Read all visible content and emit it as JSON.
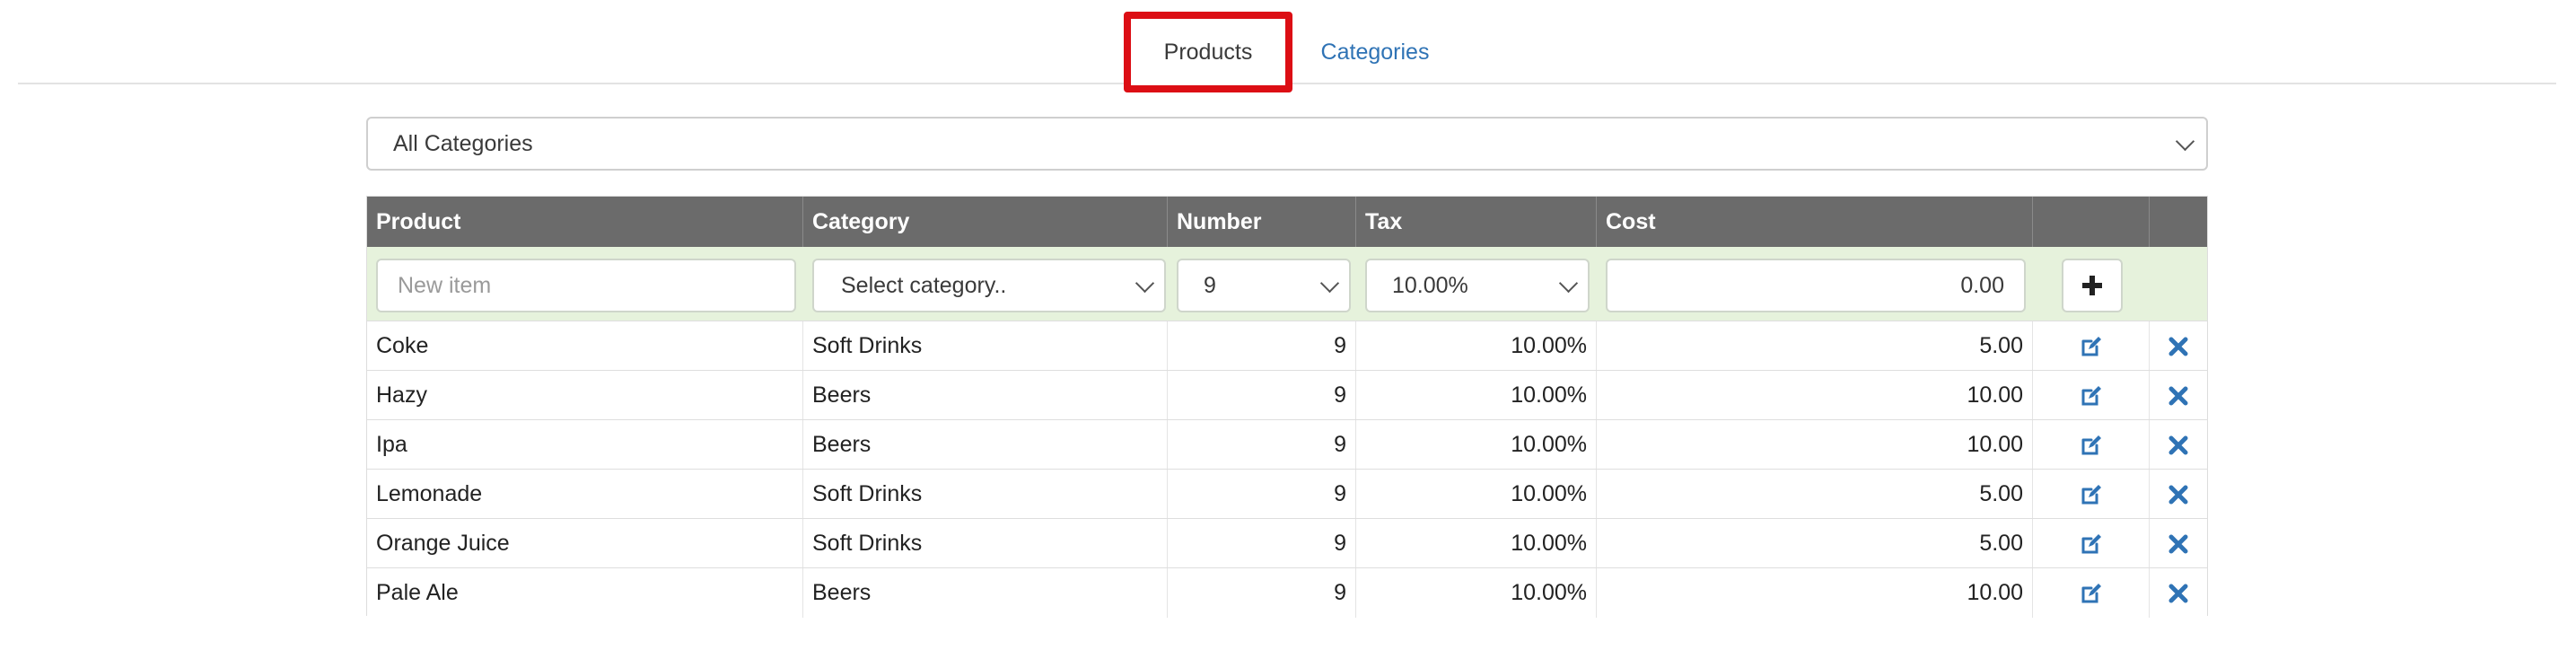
{
  "tabs": {
    "products": "Products",
    "categories": "Categories"
  },
  "filter": {
    "selected": "All Categories"
  },
  "table": {
    "headers": {
      "product": "Product",
      "category": "Category",
      "number": "Number",
      "tax": "Tax",
      "cost": "Cost"
    },
    "new_row": {
      "product_placeholder": "New item",
      "category_selected": "Select category..",
      "number_selected": "9",
      "tax_selected": "10.00%",
      "cost_value": "0.00",
      "add_icon": "plus-icon"
    },
    "rows": [
      {
        "product": "Coke",
        "category": "Soft Drinks",
        "number": "9",
        "tax": "10.00%",
        "cost": "5.00"
      },
      {
        "product": "Hazy",
        "category": "Beers",
        "number": "9",
        "tax": "10.00%",
        "cost": "10.00"
      },
      {
        "product": "Ipa",
        "category": "Beers",
        "number": "9",
        "tax": "10.00%",
        "cost": "10.00"
      },
      {
        "product": "Lemonade",
        "category": "Soft Drinks",
        "number": "9",
        "tax": "10.00%",
        "cost": "5.00"
      },
      {
        "product": "Orange Juice",
        "category": "Soft Drinks",
        "number": "9",
        "tax": "10.00%",
        "cost": "5.00"
      },
      {
        "product": "Pale Ale",
        "category": "Beers",
        "number": "9",
        "tax": "10.00%",
        "cost": "10.00"
      }
    ],
    "row_icons": {
      "edit": "edit-icon",
      "delete": "delete-icon"
    }
  },
  "colors": {
    "active_tab_highlight": "#dc0e14",
    "link": "#2f73b5",
    "header_bg": "#6b6b6b",
    "new_row_bg": "#e6f2dc",
    "action_icon": "#2f73b5"
  }
}
